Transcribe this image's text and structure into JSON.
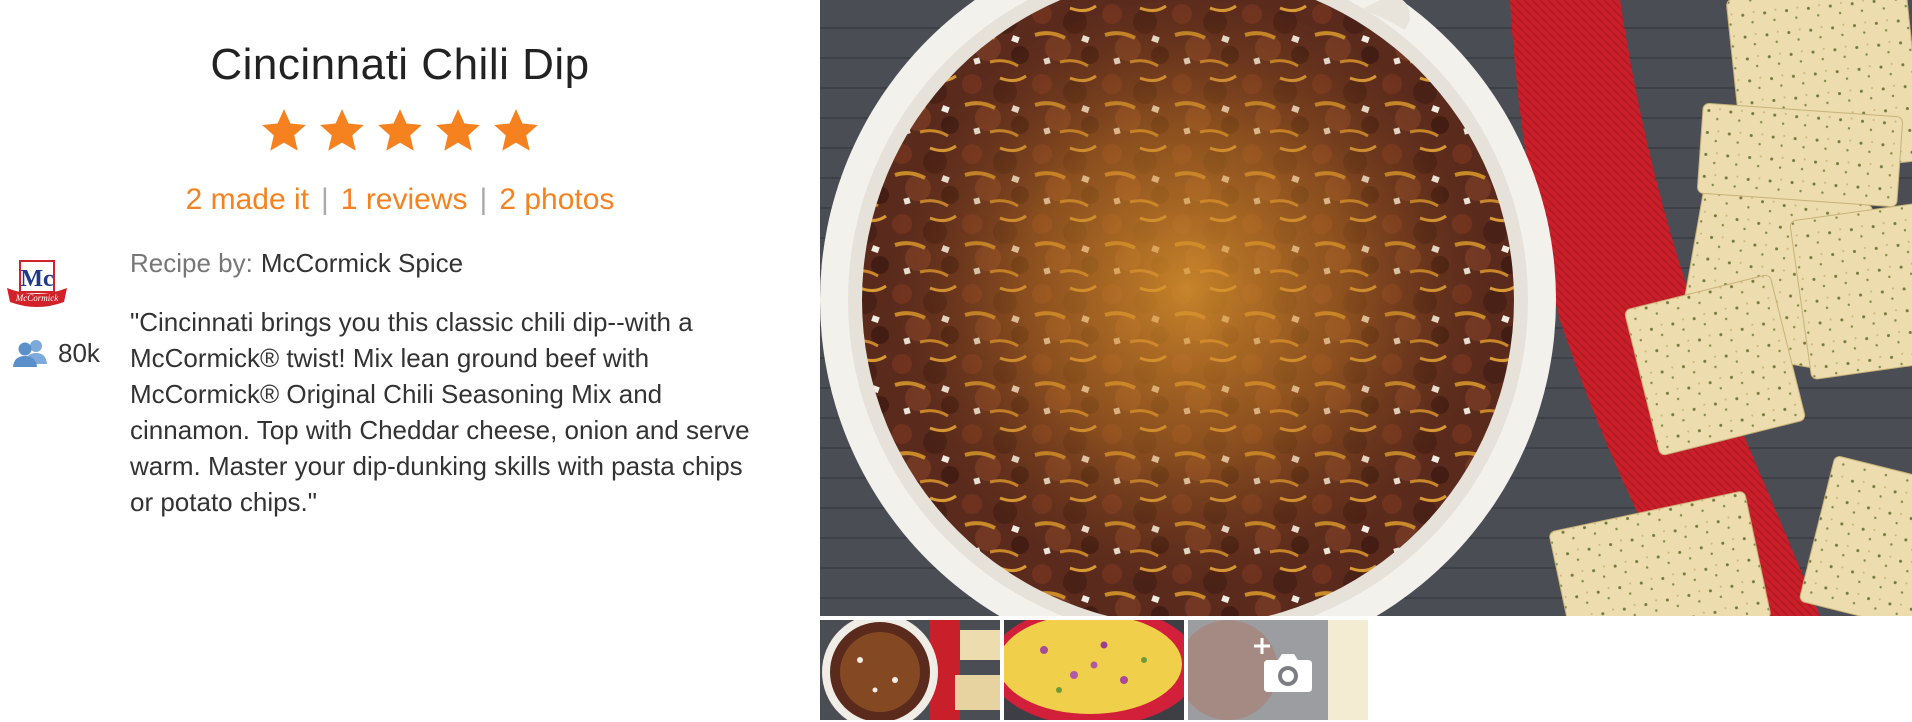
{
  "recipe": {
    "title": "Cincinnati Chili Dip",
    "rating": 5,
    "rating_max": 5,
    "made_it": "2 made it",
    "reviews": "1 reviews",
    "photos": "2 photos",
    "recipe_by_label": "Recipe by:",
    "author": "McCormick Spice",
    "author_followers": "80k",
    "description": "\"Cincinnati brings you this classic chili dip--with a McCormick® twist! Mix lean ground beef with McCormick® Original Chili Seasoning Mix and cinnamon. Top with Cheddar cheese, onion and serve warm. Master your dip-dunking skills with pasta chips or potato chips.\""
  },
  "icons": {
    "star": "star-icon",
    "followers": "people-icon",
    "add_photo": "camera-plus-icon",
    "author_logo": "mccormick-logo"
  },
  "colors": {
    "accent": "#f5821f",
    "star": "#f5821f",
    "logo_red": "#d12229",
    "logo_navy": "#1d3b8a",
    "followers_icon": "#5b8fc9"
  }
}
